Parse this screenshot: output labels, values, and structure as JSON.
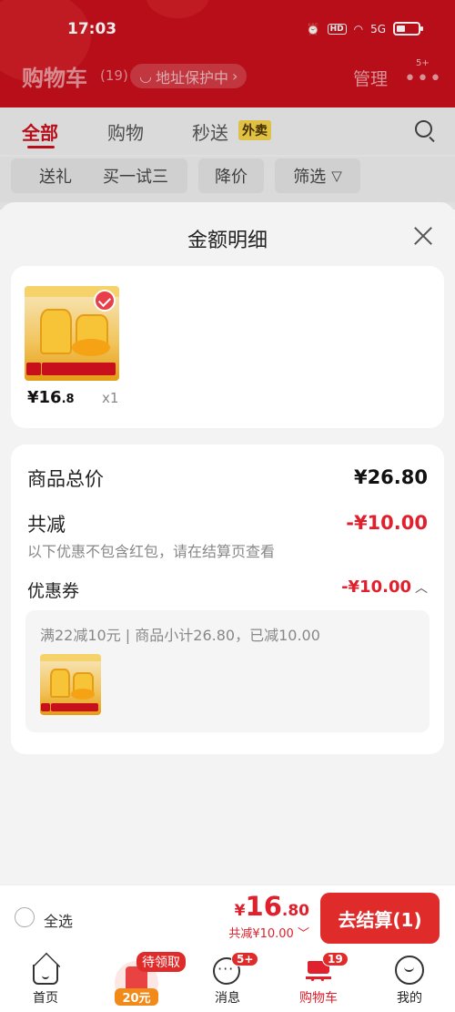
{
  "status_bar": {
    "time": "17:03",
    "hd_label": "HD",
    "network_label": "5G"
  },
  "header": {
    "title": "购物车",
    "count": "(19)",
    "address_protect": "地址保护中",
    "manage": "管理",
    "more_badge": "5+"
  },
  "tabs": [
    {
      "label": "全部"
    },
    {
      "label": "购物"
    },
    {
      "label": "秒送"
    }
  ],
  "takeout_badge": "外卖",
  "filters": [
    {
      "label": "送礼"
    },
    {
      "label": "买一试三"
    },
    {
      "label": "降价"
    },
    {
      "label": "筛选"
    }
  ],
  "sheet": {
    "title": "金额明细",
    "product": {
      "price_int": "¥16",
      "price_dec": ".8",
      "qty": "x1"
    },
    "summary": {
      "total_label": "商品总价",
      "total_value": "¥26.80",
      "discount_label": "共减",
      "discount_value": "-¥10.00",
      "discount_note": "以下优惠不包含红包，请在结算页查看",
      "coupon_label": "优惠券",
      "coupon_value": "-¥10.00",
      "coupon_detail": "满22减10元 | 商品小计26.80，已减10.00"
    }
  },
  "checkout": {
    "select_all": "全选",
    "price_currency": "¥",
    "price_int": "16",
    "price_dec": ".80",
    "discount_summary": "共减¥10.00",
    "button": "去结算(1)"
  },
  "nav": [
    {
      "label": "首页"
    },
    {
      "label": "",
      "badge": "待领取",
      "amount": "20元"
    },
    {
      "label": "消息",
      "badge": "5+"
    },
    {
      "label": "购物车",
      "badge": "19"
    },
    {
      "label": "我的"
    }
  ],
  "colors": {
    "brand_red": "#c8101d",
    "price_red": "#e0202c",
    "button_red": "#e02b2b"
  }
}
